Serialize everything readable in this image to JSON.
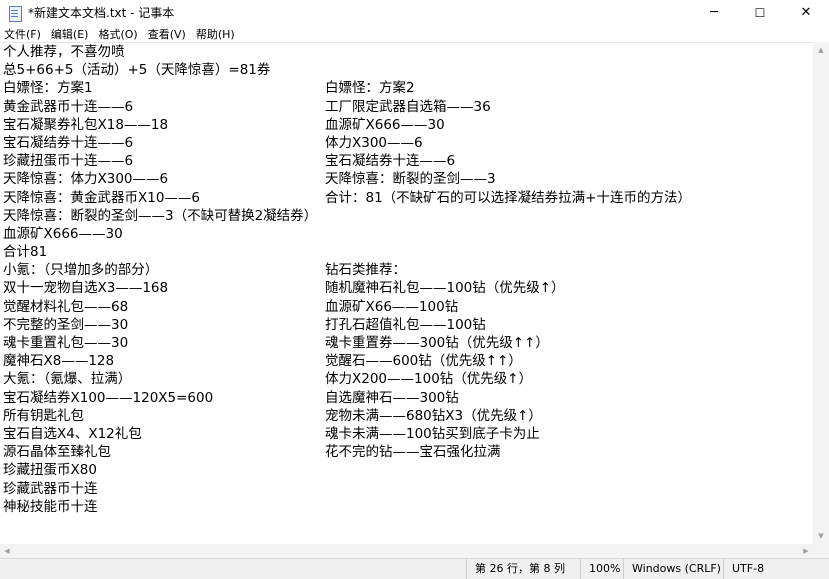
{
  "window": {
    "title": "*新建文本文档.txt - 记事本",
    "minimize_glyph": "─",
    "maximize_glyph": "☐",
    "close_glyph": "✕"
  },
  "menu": [
    {
      "label": "文件(F)"
    },
    {
      "label": "编辑(E)"
    },
    {
      "label": "格式(O)"
    },
    {
      "label": "查看(V)"
    },
    {
      "label": "帮助(H)"
    }
  ],
  "editor": {
    "left_lines": [
      "个人推荐，不喜勿喷",
      "总5+66+5（活动）+5（天降惊喜）=81券",
      "白嫖怪：方案1",
      "黄金武器币十连——6",
      "宝石凝聚券礼包X18——18",
      "宝石凝结券十连——6",
      "珍藏扭蛋币十连——6",
      "天降惊喜：体力X300——6",
      "天降惊喜：黄金武器币X10——6",
      "天降惊喜：断裂的圣剑——3（不缺可替换2凝结券）",
      "血源矿X666——30",
      "合计81",
      "小氪：（只增加多的部分）",
      "双十一宠物自选X3——168",
      "觉醒材料礼包——68",
      "不完整的圣剑——30",
      "魂卡重置礼包——30",
      "魔神石X8——128",
      "大氪：（氪爆、拉满）",
      "宝石凝结券X100——120X5=600",
      "所有钥匙礼包",
      "宝石自选X4、X12礼包",
      "源石晶体至臻礼包",
      "珍藏扭蛋币X80",
      "珍藏武器币十连",
      "神秘技能币十连"
    ],
    "right_lines": [
      "",
      "",
      "白嫖怪：方案2",
      "工厂限定武器自选箱——36",
      "血源矿X666——30",
      "体力X300——6",
      "宝石凝结券十连——6",
      "天降惊喜：断裂的圣剑——3",
      "合计：81（不缺矿石的可以选择凝结券拉满+十连币的方法）",
      "",
      "",
      "",
      "钻石类推荐：",
      "随机魔神石礼包——100钻（优先级↑）",
      "血源矿X66——100钻",
      "打孔石超值礼包——100钻",
      "魂卡重置券——300钻（优先级↑↑）",
      "觉醒石——600钻（优先级↑↑）",
      "体力X200——100钻（优先级↑）",
      "自选魔神石——300钻",
      "宠物未满——680钻X3（优先级↑）",
      "魂卡未满——100钻买到底子卡为止",
      "花不完的钻——宝石强化拉满"
    ]
  },
  "status": {
    "position": "第 26 行，第 8 列",
    "zoom": "100%",
    "line_ending": "Windows (CRLF)",
    "encoding": "UTF-8"
  }
}
